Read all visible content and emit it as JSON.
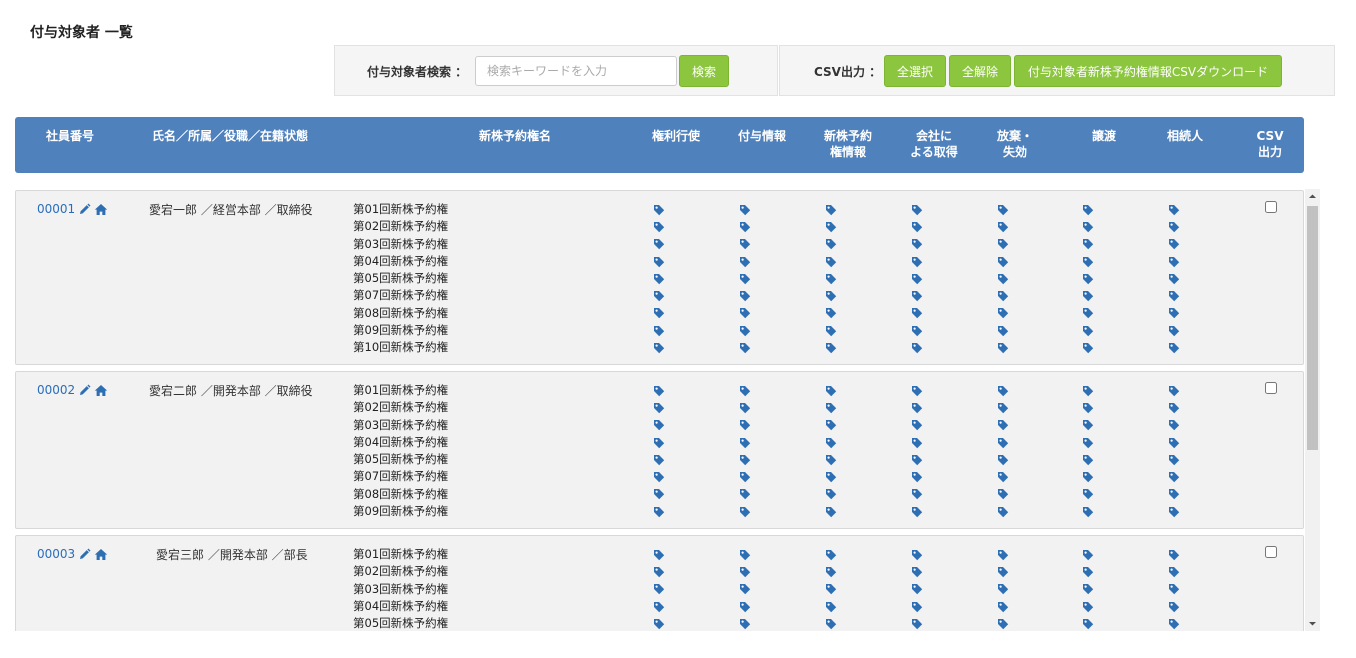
{
  "page": {
    "title": "付与対象者 一覧"
  },
  "search": {
    "label": "付与対象者検索 ：",
    "placeholder": "検索キーワードを入力",
    "value": "",
    "button": "検索"
  },
  "csv": {
    "label": "CSV出力 ：",
    "select_all": "全選択",
    "deselect_all": "全解除",
    "download": "付与対象者新株予約権情報CSVダウンロード"
  },
  "table": {
    "headers": {
      "emp_no": "社員番号",
      "name": "氏名／所属／役職／在籍状態",
      "rights": "新株予約権名",
      "exercise": "権利行使",
      "grant": "付与情報",
      "info_l1": "新株予約",
      "info_l2": "権情報",
      "acq_l1": "会社に",
      "acq_l2": "よる取得",
      "forf_l1": "放棄・",
      "forf_l2": "失効",
      "transfer": "譲渡",
      "heir": "相続人",
      "csv_l1": "CSV",
      "csv_l2": "出力"
    },
    "rows": [
      {
        "id": "00001",
        "name": "愛宕一郎 ／経営本部 ／取締役",
        "checked": false,
        "rights": [
          "第01回新株予約権",
          "第02回新株予約権",
          "第03回新株予約権",
          "第04回新株予約権",
          "第05回新株予約権",
          "第07回新株予約権",
          "第08回新株予約権",
          "第09回新株予約権",
          "第10回新株予約権"
        ]
      },
      {
        "id": "00002",
        "name": "愛宕二郎 ／開発本部 ／取締役",
        "checked": false,
        "rights": [
          "第01回新株予約権",
          "第02回新株予約権",
          "第03回新株予約権",
          "第04回新株予約権",
          "第05回新株予約権",
          "第07回新株予約権",
          "第08回新株予約権",
          "第09回新株予約権"
        ]
      },
      {
        "id": "00003",
        "name": "愛宕三郎 ／開発本部 ／部長",
        "checked": false,
        "rights": [
          "第01回新株予約権",
          "第02回新株予約権",
          "第03回新株予約権",
          "第04回新株予約権",
          "第05回新株予約権"
        ]
      }
    ]
  },
  "icons": {
    "edit": "pencil-icon",
    "home": "home-icon",
    "tag": "tag-icon"
  },
  "colors": {
    "accent": "#4f81bd",
    "button": "#8cc63e",
    "link": "#2a6ebb"
  }
}
